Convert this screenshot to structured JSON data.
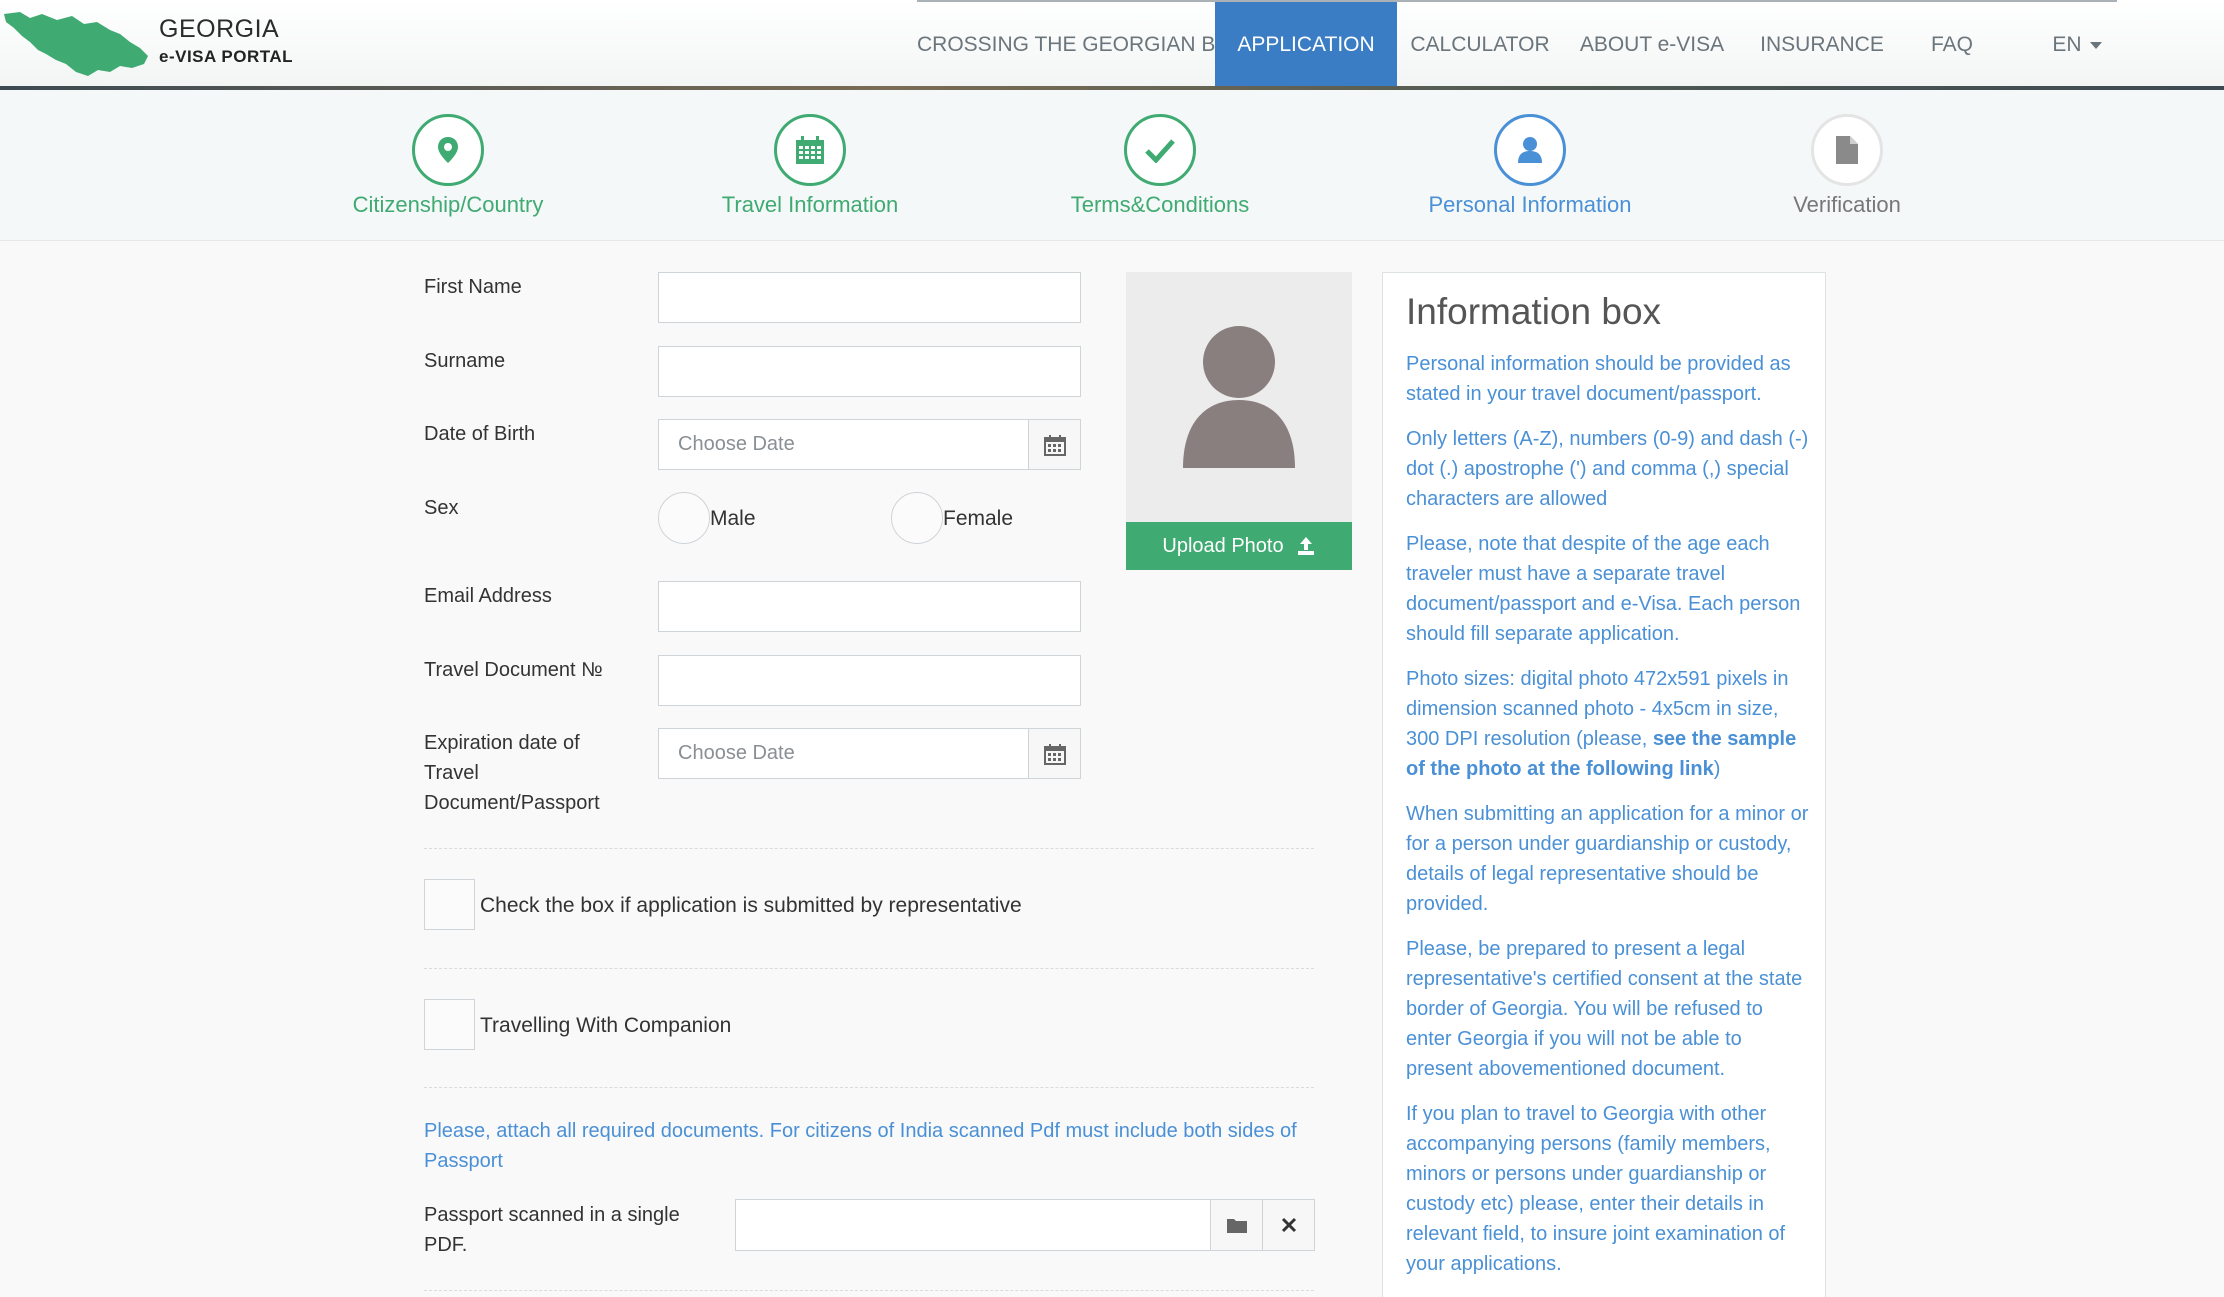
{
  "header": {
    "brand_title": "GEORGIA",
    "brand_subtitle": "e-VISA PORTAL",
    "nav": [
      {
        "label": "CROSSING THE GEORGIAN BORDER"
      },
      {
        "label": "APPLICATION",
        "active": true
      },
      {
        "label": "CALCULATOR"
      },
      {
        "label": "ABOUT e-VISA"
      },
      {
        "label": "INSURANCE"
      },
      {
        "label": "FAQ"
      },
      {
        "label": "EN"
      }
    ]
  },
  "steps": [
    {
      "label": "Citizenship/Country",
      "icon": "map-pin-icon",
      "state": "done"
    },
    {
      "label": "Travel Information",
      "icon": "calendar-icon",
      "state": "done"
    },
    {
      "label": "Terms&Conditions",
      "icon": "checkmark-icon",
      "state": "done"
    },
    {
      "label": "Personal Information",
      "icon": "user-icon",
      "state": "current"
    },
    {
      "label": "Verification",
      "icon": "document-icon",
      "state": "pending"
    }
  ],
  "form": {
    "first_name_label": "First Name",
    "surname_label": "Surname",
    "dob_label": "Date of Birth",
    "dob_placeholder": "Choose Date",
    "sex_label": "Sex",
    "sex_male": "Male",
    "sex_female": "Female",
    "email_label": "Email Address",
    "travel_doc_label": "Travel Document №",
    "expiration_label_1": "Expiration date of",
    "expiration_label_2": "Travel",
    "expiration_label_3": "Document/Passport",
    "expiration_placeholder": "Choose Date",
    "representative_label": "Check the box if application is submitted by representative",
    "companion_label": "Travelling With Companion",
    "attach_note": "Please, attach all required documents. For citizens of India scanned Pdf must include both sides of Passport",
    "passport_pdf_label_1": "Passport scanned in a single",
    "passport_pdf_label_2": "PDF."
  },
  "photo": {
    "upload_label": "Upload Photo"
  },
  "info_box": {
    "title": "Information box",
    "p1": "Personal information should be provided as stated in your travel document/passport.",
    "p2": "Only letters (A-Z), numbers (0-9) and dash (-) dot (.) apostrophe (') and comma (,) special characters are allowed",
    "p3": "Please, note that despite of the age each traveler must have a separate travel document/passport and e-Visa. Each person should fill separate application.",
    "p4_pre": "Photo sizes: digital photo 472x591 pixels in dimension scanned photo - 4x5cm in size, 300 DPI resolution (please, ",
    "p4_link": "see the sample of the photo at the following link",
    "p4_post": ")",
    "p5": "When submitting an application for a minor or for a person under guardianship or custody, details of legal representative should be provided.",
    "p6": "Please, be prepared to present a legal representative's certified consent at the state border of Georgia. You will be refused to enter Georgia if you will not be able to present abovementioned document.",
    "p7": "If you plan to travel to Georgia with other accompanying persons (family members, minors or persons under guardianship or custody etc) please, enter their details in relevant field, to insure joint examination of your applications."
  },
  "colors": {
    "accent_green": "#3faa72",
    "accent_blue": "#4a90d6",
    "nav_active": "#3b7dc4"
  }
}
